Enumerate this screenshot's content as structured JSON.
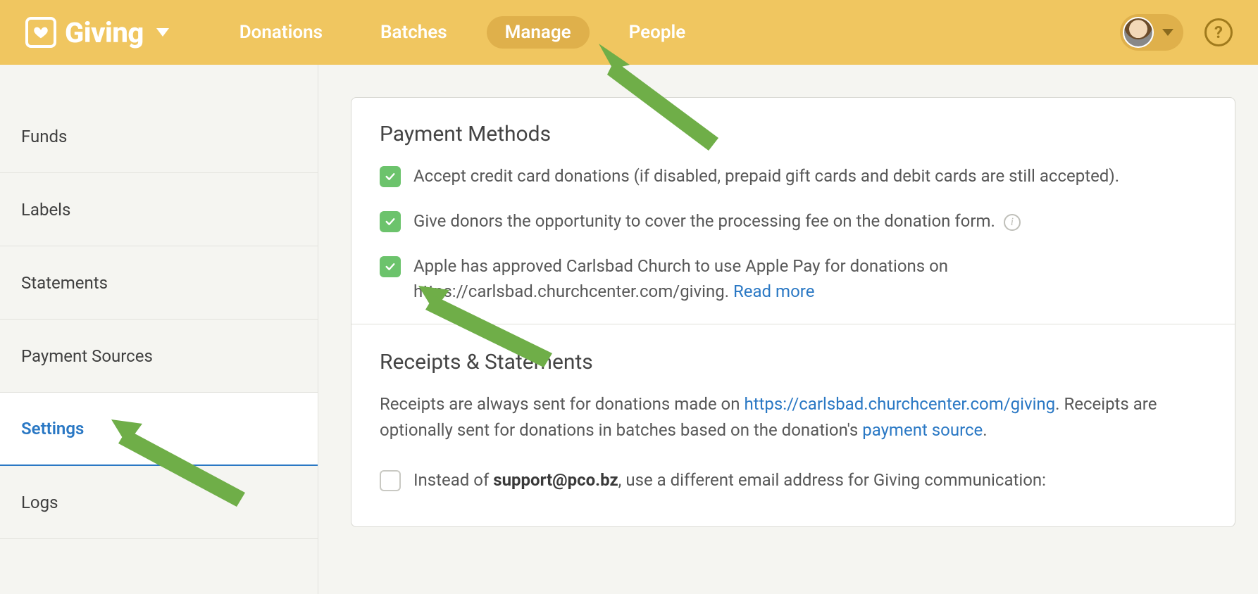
{
  "brand": {
    "name": "Giving"
  },
  "nav": {
    "items": [
      {
        "label": "Donations"
      },
      {
        "label": "Batches"
      },
      {
        "label": "Manage",
        "active": true
      },
      {
        "label": "People"
      }
    ]
  },
  "sidebar": {
    "items": [
      {
        "label": "Funds"
      },
      {
        "label": "Labels"
      },
      {
        "label": "Statements"
      },
      {
        "label": "Payment Sources"
      },
      {
        "label": "Settings",
        "active": true
      },
      {
        "label": "Logs"
      }
    ]
  },
  "sections": {
    "payment_methods": {
      "title": "Payment Methods",
      "opts": [
        {
          "checked": true,
          "text": "Accept credit card donations (if disabled, prepaid gift cards and debit cards are still accepted)."
        },
        {
          "checked": true,
          "text": "Give donors the opportunity to cover the processing fee on the donation form."
        },
        {
          "checked": true,
          "text_pre": "Apple has approved Carlsbad Church to use Apple Pay for donations on https://carlsbad.churchcenter.com/giving. ",
          "link": "Read more"
        }
      ]
    },
    "receipts": {
      "title": "Receipts & Statements",
      "paragraph": {
        "p1_a": "Receipts are always sent for donations made on ",
        "p1_link": "https://carlsbad.churchcenter.com/giving",
        "p1_b": ". Receipts are optionally sent for donations in batches based on the donation's ",
        "p1_link2": "payment source",
        "p1_c": "."
      },
      "opt": {
        "checked": false,
        "pre": "Instead of ",
        "bold": "support@pco.bz",
        "post": ", use a different email address for Giving communication:"
      }
    }
  }
}
